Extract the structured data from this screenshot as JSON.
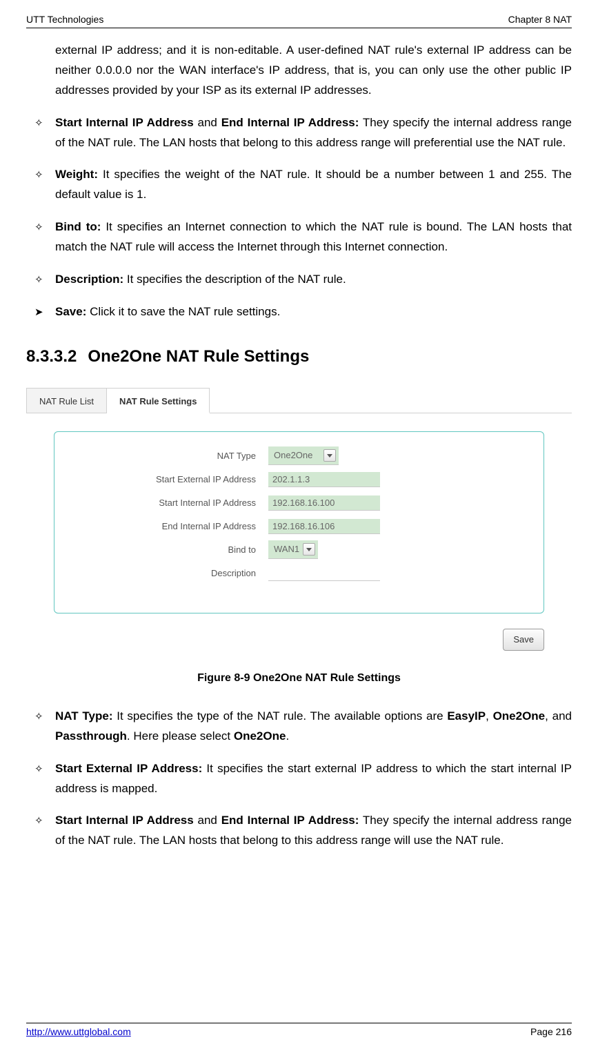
{
  "header": {
    "left": "UTT Technologies",
    "right": "Chapter 8 NAT"
  },
  "footer": {
    "url": "http://www.uttglobal.com",
    "page": "Page 216"
  },
  "para_intro": "external IP address; and it is non-editable. A user-defined NAT rule's external IP address can be neither 0.0.0.0 nor the WAN interface's IP address, that is, you can only use the other public IP addresses provided by your ISP as its external IP addresses.",
  "bullets_top": [
    {
      "marker": "✧",
      "bold": "Start Internal IP Address",
      "mid": " and ",
      "bold2": "End Internal IP Address:",
      "rest": " They specify the internal address range of the NAT rule. The LAN hosts that belong to this address range will preferential use the NAT rule."
    },
    {
      "marker": "✧",
      "bold": "Weight:",
      "rest": " It specifies the weight of the NAT rule. It should be a number between 1 and 255. The default value is 1."
    },
    {
      "marker": "✧",
      "bold": "Bind to:",
      "rest": " It specifies an Internet connection to which the NAT rule is bound. The LAN hosts that match the NAT rule will access the Internet through this Internet connection."
    },
    {
      "marker": "✧",
      "bold": "Description:",
      "rest": " It specifies the description of the NAT rule."
    },
    {
      "marker": "➤",
      "bold": "Save:",
      "rest": " Click it to save the NAT rule settings."
    }
  ],
  "section": {
    "num": "8.3.3.2",
    "title": "One2One NAT Rule Settings"
  },
  "ui": {
    "tab_inactive": "NAT Rule List",
    "tab_active": "NAT Rule Settings",
    "rows": {
      "nat_type": {
        "label": "NAT Type",
        "value": "One2One"
      },
      "start_ext": {
        "label": "Start External IP Address",
        "value": "202.1.1.3"
      },
      "start_int": {
        "label": "Start Internal IP Address",
        "value": "192.168.16.100"
      },
      "end_int": {
        "label": "End Internal IP Address",
        "value": "192.168.16.106"
      },
      "bind_to": {
        "label": "Bind to",
        "value": "WAN1"
      },
      "desc": {
        "label": "Description",
        "value": ""
      }
    },
    "save": "Save"
  },
  "figcap": "Figure 8-9 One2One NAT Rule Settings",
  "bullets_bottom": [
    {
      "marker": "✧",
      "lead": "NAT Type:",
      "text1": " It specifies the type of the NAT rule. The available options are ",
      "opt1": "EasyIP",
      "text2": ", ",
      "opt2": "One2One",
      "text3": ", and ",
      "opt3": "Passthrough",
      "text4": ". Here please select ",
      "opt4": "One2One",
      "text5": "."
    },
    {
      "marker": "✧",
      "lead": "Start External IP Address:",
      "text1": " It specifies the start external IP address to which the start internal IP address is mapped."
    },
    {
      "marker": "✧",
      "lead": "Start Internal IP Address",
      "mid": " and ",
      "lead2": "End Internal IP Address:",
      "text1": " They specify the internal address range of the NAT rule. The LAN hosts that belong to this address range will use the NAT rule."
    }
  ]
}
